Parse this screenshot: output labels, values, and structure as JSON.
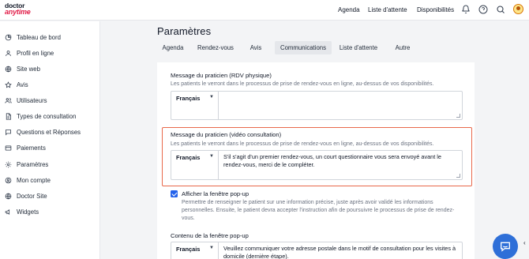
{
  "brand": {
    "top": "doctor",
    "bottom": "anytime"
  },
  "topnav": {
    "agenda": "Agenda",
    "waitlist": "Liste d'attente",
    "availability": "Disponibilités"
  },
  "icons": {
    "bell": "bell-icon",
    "help": "help-icon",
    "search": "search-icon",
    "chat": "chat-icon"
  },
  "sidebar": {
    "items": [
      {
        "label": "Tableau de bord",
        "icon": "dashboard-icon"
      },
      {
        "label": "Profil en ligne",
        "icon": "user-icon"
      },
      {
        "label": "Site web",
        "icon": "globe-icon"
      },
      {
        "label": "Avis",
        "icon": "star-icon"
      },
      {
        "label": "Utilisateurs",
        "icon": "users-icon"
      },
      {
        "label": "Types de consultation",
        "icon": "document-icon"
      },
      {
        "label": "Questions et Réponses",
        "icon": "chat-bubble-icon"
      },
      {
        "label": "Paiements",
        "icon": "payment-icon"
      },
      {
        "label": "Paramètres",
        "icon": "gear-icon"
      },
      {
        "label": "Mon compte",
        "icon": "user-circle-icon"
      },
      {
        "label": "Doctor Site",
        "icon": "globe-icon"
      },
      {
        "label": "Widgets",
        "icon": "megaphone-icon"
      }
    ]
  },
  "page": {
    "title": "Paramètres"
  },
  "tabs": [
    {
      "label": "Agenda",
      "active": false
    },
    {
      "label": "Rendez-vous",
      "active": false
    },
    {
      "label": "Avis",
      "active": false
    },
    {
      "label": "Communications",
      "active": true
    },
    {
      "label": "Liste d'attente",
      "active": false
    },
    {
      "label": "Autre",
      "active": false
    }
  ],
  "sections": {
    "physical": {
      "title": "Message du praticien (RDV physique)",
      "desc": "Les patients le verront dans le processus de prise de rendez-vous en ligne, au-dessus de vos disponibilités.",
      "lang": "Français",
      "text": ""
    },
    "video": {
      "title": "Message du praticien (vidéo consultation)",
      "desc": "Les patients le verront dans le processus de prise de rendez-vous en ligne, au-dessus de vos disponibilités.",
      "lang": "Français",
      "text": "S'il s'agit d'un premier rendez-vous, un court questionnaire vous sera envoyé avant le rendez-vous, merci de le compléter."
    },
    "popup": {
      "checked": true,
      "label": "Afficher la fenêtre pop-up",
      "desc": "Permettre de renseigner le patient sur une information précise, juste après avoir validé les informations personnelles. Ensuite, le patient devra accepter l'instruction afin de poursuivre le processus de prise de rendez-vous."
    },
    "popup_content": {
      "title": "Contenu de la fenêtre pop-up",
      "lang": "Français",
      "text": "Veuillez communiquer votre adresse postale dans le motif de consultation pour les visites à domicile (dernière étape)."
    }
  },
  "colors": {
    "accent": "#2e6fd8",
    "highlight": "#e8684a",
    "brand": "#e11d48"
  }
}
